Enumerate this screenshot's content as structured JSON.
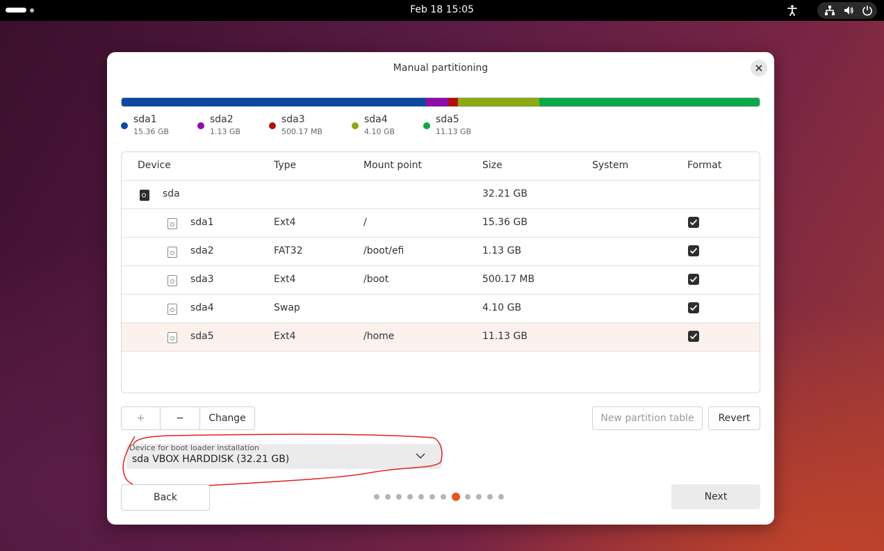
{
  "topbar": {
    "clock": "Feb 18  15:05",
    "icons": [
      "accessibility-icon",
      "network-icon",
      "volume-icon",
      "power-icon"
    ]
  },
  "dialog": {
    "title": "Manual partitioning"
  },
  "partition_bar": [
    {
      "name": "sda1",
      "size": "15.36 GB",
      "color": "#0d47a1",
      "fraction": 0.4768
    },
    {
      "name": "sda2",
      "size": "1.13 GB",
      "color": "#8e0ea8",
      "fraction": 0.0351
    },
    {
      "name": "sda3",
      "size": "500.17 MB",
      "color": "#b0100e",
      "fraction": 0.0155
    },
    {
      "name": "sda4",
      "size": "4.10 GB",
      "color": "#8ca812",
      "fraction": 0.1273
    },
    {
      "name": "sda5",
      "size": "11.13 GB",
      "color": "#0aa84a",
      "fraction": 0.3453
    }
  ],
  "table": {
    "headers": {
      "device": "Device",
      "type": "Type",
      "mount": "Mount point",
      "size": "Size",
      "system": "System",
      "format": "Format"
    },
    "disk": {
      "device": "sda",
      "size": "32.21 GB"
    },
    "rows": [
      {
        "device": "sda1",
        "type": "Ext4",
        "mount": "/",
        "size": "15.36 GB",
        "format": true
      },
      {
        "device": "sda2",
        "type": "FAT32",
        "mount": "/boot/efi",
        "size": "1.13 GB",
        "format": true
      },
      {
        "device": "sda3",
        "type": "Ext4",
        "mount": "/boot",
        "size": "500.17 MB",
        "format": true
      },
      {
        "device": "sda4",
        "type": "Swap",
        "mount": "",
        "size": "4.10 GB",
        "format": true
      },
      {
        "device": "sda5",
        "type": "Ext4",
        "mount": "/home",
        "size": "11.13 GB",
        "format": true,
        "selected": true
      }
    ]
  },
  "actions": {
    "add": "+",
    "remove": "−",
    "change": "Change",
    "new_table": "New partition table",
    "revert": "Revert"
  },
  "bootloader": {
    "label": "Device for boot loader installation",
    "value": "sda VBOX HARDDISK (32.21 GB)"
  },
  "nav": {
    "back": "Back",
    "next": "Next",
    "step_count": 12,
    "current_step": 8
  },
  "colors": {
    "accent": "#e95420",
    "annotation": "#e0201a"
  }
}
